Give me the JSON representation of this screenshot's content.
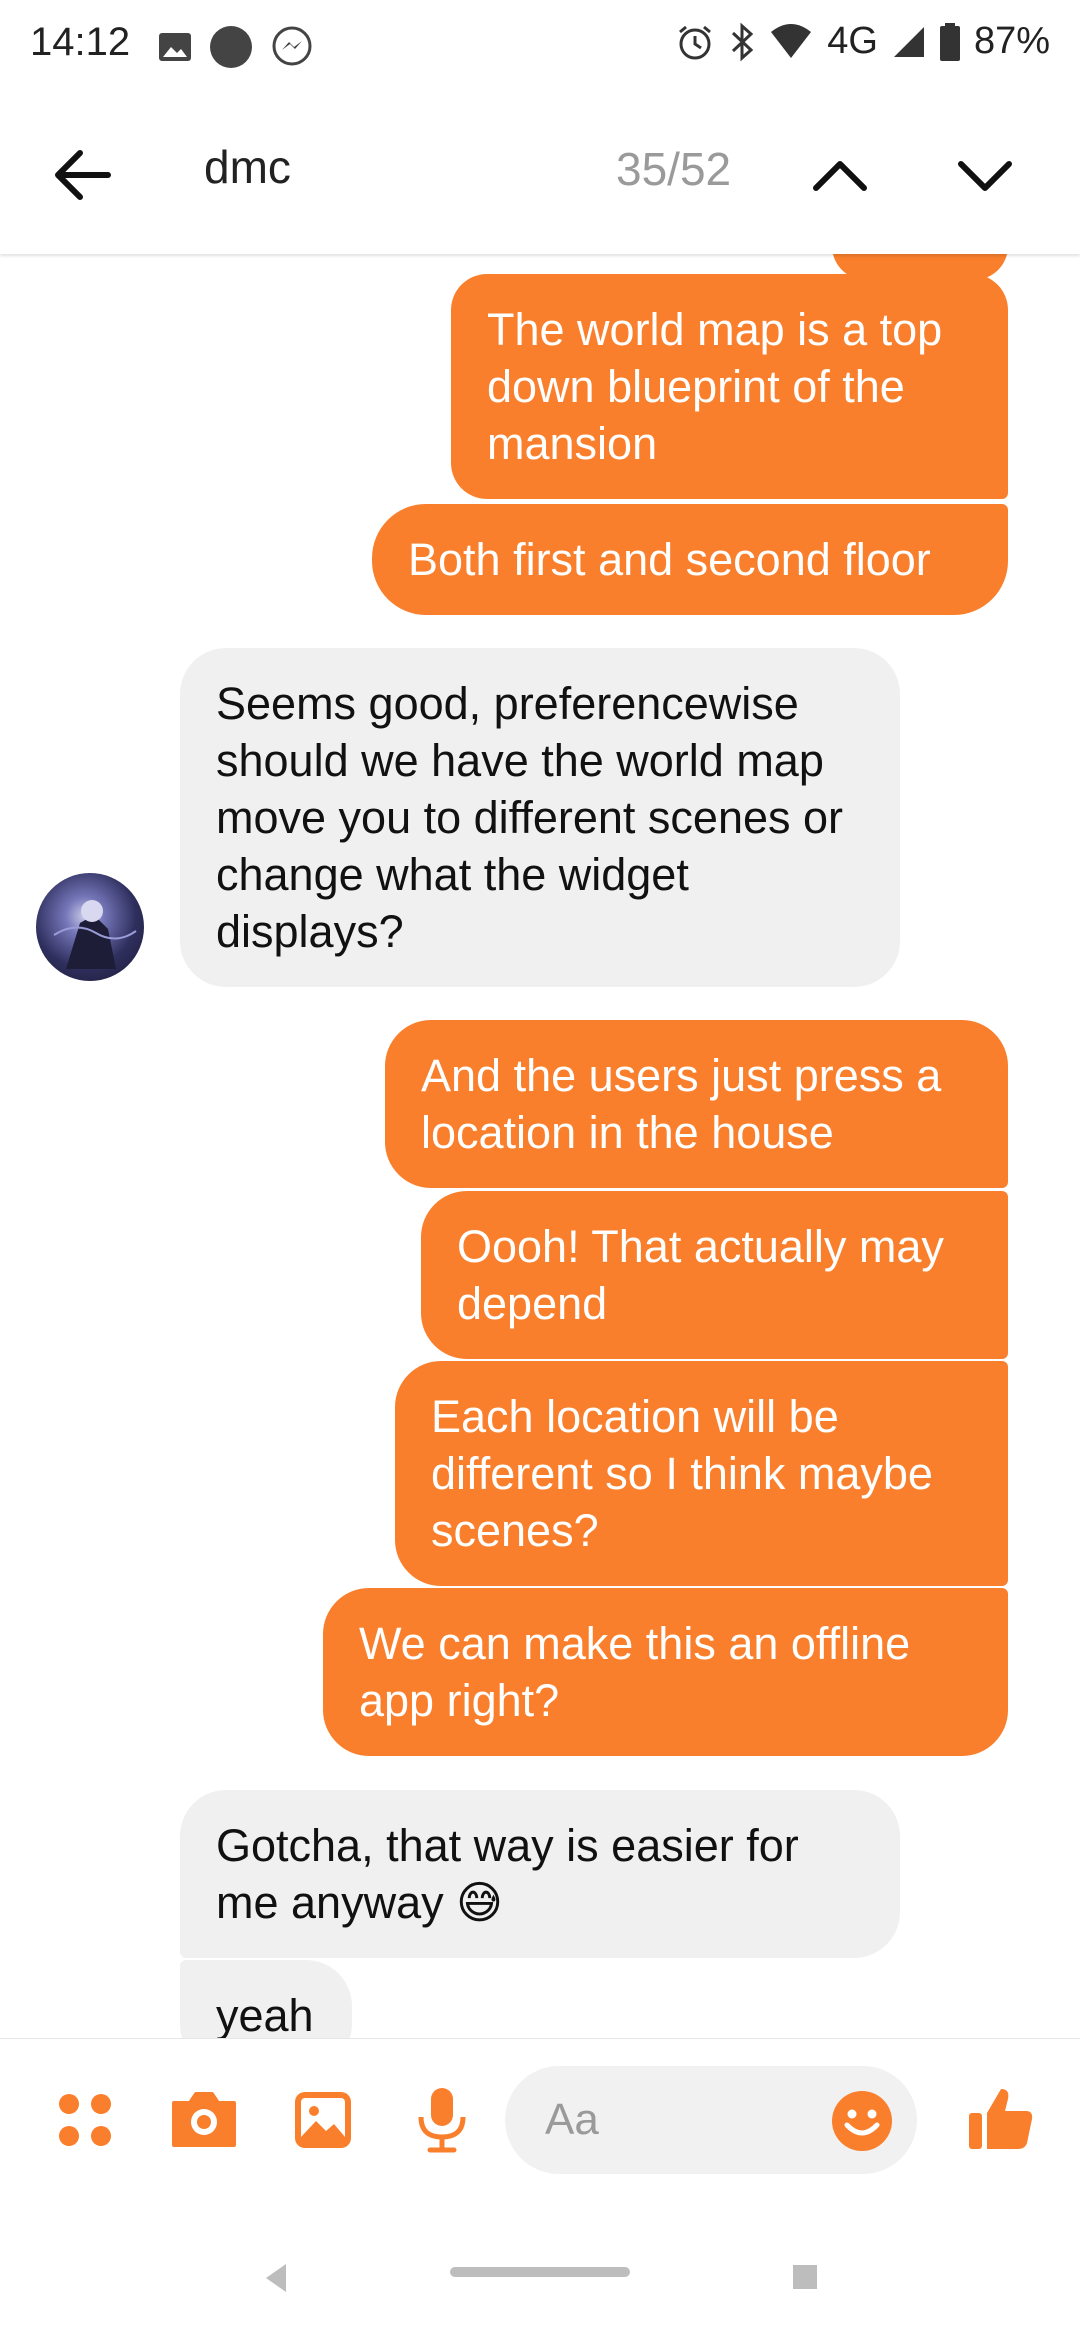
{
  "status_bar": {
    "time": "14:12",
    "network": "4G",
    "battery": "87%"
  },
  "header": {
    "search_term": "dmc",
    "match_count": "35/52"
  },
  "messages": [
    {
      "side": "out",
      "text": "The world map is a top down blueprint of the mansion"
    },
    {
      "side": "out",
      "text": "Both first and second floor"
    },
    {
      "side": "in",
      "text": "Seems good, preferencewise should we have the world map move you to different scenes or  change what the widget displays?"
    },
    {
      "side": "out",
      "text": "And the users just press a location in the house"
    },
    {
      "side": "out",
      "text": "Oooh! That actually may depend"
    },
    {
      "side": "out",
      "text": "Each location will be different so I think maybe scenes?"
    },
    {
      "side": "out",
      "text": "We can make this an offline app right?"
    },
    {
      "side": "in",
      "text": "Gotcha, that way is easier for me anyway",
      "emoji": "😅"
    },
    {
      "side": "in",
      "text": "yeah"
    }
  ],
  "composer": {
    "placeholder": "Aa"
  },
  "colors": {
    "accent": "#fa7f2c",
    "incoming_bubble": "#f0f0f0"
  }
}
